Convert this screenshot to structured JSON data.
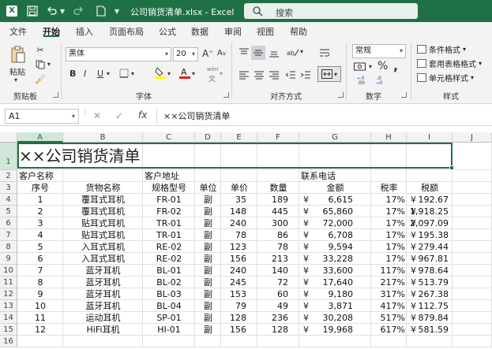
{
  "window": {
    "title": "公司销货清单.xlsx  -  Excel",
    "search_placeholder": "搜索"
  },
  "tabs": [
    "文件",
    "开始",
    "插入",
    "页面布局",
    "公式",
    "数据",
    "审阅",
    "视图",
    "帮助"
  ],
  "active_tab": "开始",
  "ribbon": {
    "clipboard": {
      "paste": "粘贴",
      "label": "剪贴板"
    },
    "font": {
      "name": "黑体",
      "size": "20",
      "grow": "A",
      "shrink": "A",
      "bold": "B",
      "italic": "I",
      "underline": "U",
      "wen": "wén",
      "label": "字体"
    },
    "alignment": {
      "label": "对齐方式"
    },
    "number": {
      "format": "常规",
      "label": "数字",
      "dec_inc": ".00",
      "dec_dec": ".0"
    },
    "styles": {
      "conditional": "条件格式",
      "table": "套用表格格式",
      "cell": "单元格样式",
      "label": "样式"
    }
  },
  "formula_bar": {
    "name_box": "A1",
    "fx": "fx",
    "content": "××公司销货清单"
  },
  "columns": [
    "A",
    "B",
    "C",
    "D",
    "E",
    "F",
    "G",
    "H",
    "I",
    "J"
  ],
  "selected_column": "A",
  "rows": [
    "1",
    "2",
    "3",
    "4",
    "5",
    "6",
    "7",
    "8",
    "9",
    "10",
    "11",
    "12",
    "13",
    "14",
    "15",
    "16"
  ],
  "selected_row": "1",
  "sheet": {
    "title": "××公司销货清单",
    "row2": {
      "a": "客户名称",
      "c": "客户地址",
      "g": "联系电话"
    },
    "headers": {
      "a": "序号",
      "b": "货物名称",
      "c": "规格型号",
      "d": "单位",
      "e": "单价",
      "f": "数量",
      "g": "金额",
      "h": "税率",
      "i": "税额"
    },
    "currency": "¥",
    "data": [
      {
        "no": "1",
        "name": "覆耳式耳机",
        "model": "FR-01",
        "unit": "副",
        "price": "35",
        "qty": "189",
        "amount": "6,615",
        "rate": "17%",
        "tax": "192.67"
      },
      {
        "no": "2",
        "name": "覆耳式耳机",
        "model": "FR-02",
        "unit": "副",
        "price": "148",
        "qty": "445",
        "amount": "65,860",
        "rate": "17%",
        "tax": "1,918.25"
      },
      {
        "no": "3",
        "name": "贴耳式耳机",
        "model": "TR-01",
        "unit": "副",
        "price": "240",
        "qty": "300",
        "amount": "72,000",
        "rate": "17%",
        "tax": "2,097.09"
      },
      {
        "no": "4",
        "name": "贴耳式耳机",
        "model": "TR-01",
        "unit": "副",
        "price": "78",
        "qty": "86",
        "amount": "6,708",
        "rate": "17%",
        "tax": "195.38"
      },
      {
        "no": "5",
        "name": "入耳式耳机",
        "model": "RE-02",
        "unit": "副",
        "price": "123",
        "qty": "78",
        "amount": "9,594",
        "rate": "17%",
        "tax": "279.44"
      },
      {
        "no": "6",
        "name": "入耳式耳机",
        "model": "RE-02",
        "unit": "副",
        "price": "156",
        "qty": "213",
        "amount": "33,228",
        "rate": "17%",
        "tax": "967.81"
      },
      {
        "no": "7",
        "name": "蓝牙耳机",
        "model": "BL-01",
        "unit": "副",
        "price": "240",
        "qty": "140",
        "amount": "33,600",
        "rate": "117%",
        "tax": "978.64"
      },
      {
        "no": "8",
        "name": "蓝牙耳机",
        "model": "BL-02",
        "unit": "副",
        "price": "245",
        "qty": "72",
        "amount": "17,640",
        "rate": "217%",
        "tax": "513.79"
      },
      {
        "no": "9",
        "name": "蓝牙耳机",
        "model": "BL-03",
        "unit": "副",
        "price": "153",
        "qty": "60",
        "amount": "9,180",
        "rate": "317%",
        "tax": "267.38"
      },
      {
        "no": "10",
        "name": "蓝牙耳机",
        "model": "BL-04",
        "unit": "副",
        "price": "79",
        "qty": "49",
        "amount": "3,871",
        "rate": "417%",
        "tax": "112.75"
      },
      {
        "no": "11",
        "name": "运动耳机",
        "model": "SP-01",
        "unit": "副",
        "price": "128",
        "qty": "236",
        "amount": "30,208",
        "rate": "517%",
        "tax": "879.84"
      },
      {
        "no": "12",
        "name": "HiFi耳机",
        "model": "HI-01",
        "unit": "副",
        "price": "156",
        "qty": "128",
        "amount": "19,968",
        "rate": "617%",
        "tax": "581.59"
      }
    ]
  },
  "colors": {
    "excel_green": "#1f7145",
    "selection": "#d2e6d9"
  }
}
